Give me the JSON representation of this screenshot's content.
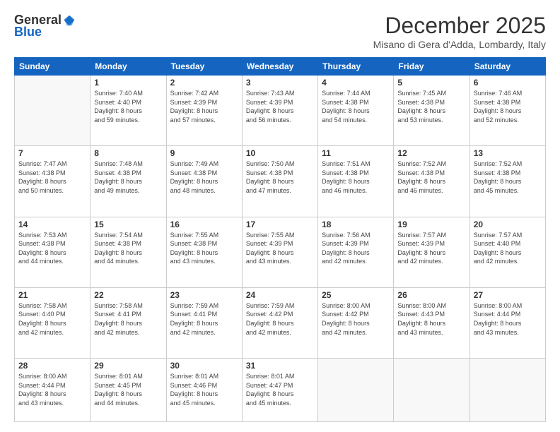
{
  "header": {
    "logo": {
      "general": "General",
      "blue": "Blue"
    },
    "title": "December 2025",
    "location": "Misano di Gera d'Adda, Lombardy, Italy"
  },
  "weekdays": [
    "Sunday",
    "Monday",
    "Tuesday",
    "Wednesday",
    "Thursday",
    "Friday",
    "Saturday"
  ],
  "weeks": [
    [
      {
        "day": "",
        "sunrise": "",
        "sunset": "",
        "daylight": ""
      },
      {
        "day": "1",
        "sunrise": "Sunrise: 7:40 AM",
        "sunset": "Sunset: 4:40 PM",
        "daylight": "Daylight: 8 hours and 59 minutes."
      },
      {
        "day": "2",
        "sunrise": "Sunrise: 7:42 AM",
        "sunset": "Sunset: 4:39 PM",
        "daylight": "Daylight: 8 hours and 57 minutes."
      },
      {
        "day": "3",
        "sunrise": "Sunrise: 7:43 AM",
        "sunset": "Sunset: 4:39 PM",
        "daylight": "Daylight: 8 hours and 56 minutes."
      },
      {
        "day": "4",
        "sunrise": "Sunrise: 7:44 AM",
        "sunset": "Sunset: 4:38 PM",
        "daylight": "Daylight: 8 hours and 54 minutes."
      },
      {
        "day": "5",
        "sunrise": "Sunrise: 7:45 AM",
        "sunset": "Sunset: 4:38 PM",
        "daylight": "Daylight: 8 hours and 53 minutes."
      },
      {
        "day": "6",
        "sunrise": "Sunrise: 7:46 AM",
        "sunset": "Sunset: 4:38 PM",
        "daylight": "Daylight: 8 hours and 52 minutes."
      }
    ],
    [
      {
        "day": "7",
        "sunrise": "Sunrise: 7:47 AM",
        "sunset": "Sunset: 4:38 PM",
        "daylight": "Daylight: 8 hours and 50 minutes."
      },
      {
        "day": "8",
        "sunrise": "Sunrise: 7:48 AM",
        "sunset": "Sunset: 4:38 PM",
        "daylight": "Daylight: 8 hours and 49 minutes."
      },
      {
        "day": "9",
        "sunrise": "Sunrise: 7:49 AM",
        "sunset": "Sunset: 4:38 PM",
        "daylight": "Daylight: 8 hours and 48 minutes."
      },
      {
        "day": "10",
        "sunrise": "Sunrise: 7:50 AM",
        "sunset": "Sunset: 4:38 PM",
        "daylight": "Daylight: 8 hours and 47 minutes."
      },
      {
        "day": "11",
        "sunrise": "Sunrise: 7:51 AM",
        "sunset": "Sunset: 4:38 PM",
        "daylight": "Daylight: 8 hours and 46 minutes."
      },
      {
        "day": "12",
        "sunrise": "Sunrise: 7:52 AM",
        "sunset": "Sunset: 4:38 PM",
        "daylight": "Daylight: 8 hours and 46 minutes."
      },
      {
        "day": "13",
        "sunrise": "Sunrise: 7:52 AM",
        "sunset": "Sunset: 4:38 PM",
        "daylight": "Daylight: 8 hours and 45 minutes."
      }
    ],
    [
      {
        "day": "14",
        "sunrise": "Sunrise: 7:53 AM",
        "sunset": "Sunset: 4:38 PM",
        "daylight": "Daylight: 8 hours and 44 minutes."
      },
      {
        "day": "15",
        "sunrise": "Sunrise: 7:54 AM",
        "sunset": "Sunset: 4:38 PM",
        "daylight": "Daylight: 8 hours and 44 minutes."
      },
      {
        "day": "16",
        "sunrise": "Sunrise: 7:55 AM",
        "sunset": "Sunset: 4:38 PM",
        "daylight": "Daylight: 8 hours and 43 minutes."
      },
      {
        "day": "17",
        "sunrise": "Sunrise: 7:55 AM",
        "sunset": "Sunset: 4:39 PM",
        "daylight": "Daylight: 8 hours and 43 minutes."
      },
      {
        "day": "18",
        "sunrise": "Sunrise: 7:56 AM",
        "sunset": "Sunset: 4:39 PM",
        "daylight": "Daylight: 8 hours and 42 minutes."
      },
      {
        "day": "19",
        "sunrise": "Sunrise: 7:57 AM",
        "sunset": "Sunset: 4:39 PM",
        "daylight": "Daylight: 8 hours and 42 minutes."
      },
      {
        "day": "20",
        "sunrise": "Sunrise: 7:57 AM",
        "sunset": "Sunset: 4:40 PM",
        "daylight": "Daylight: 8 hours and 42 minutes."
      }
    ],
    [
      {
        "day": "21",
        "sunrise": "Sunrise: 7:58 AM",
        "sunset": "Sunset: 4:40 PM",
        "daylight": "Daylight: 8 hours and 42 minutes."
      },
      {
        "day": "22",
        "sunrise": "Sunrise: 7:58 AM",
        "sunset": "Sunset: 4:41 PM",
        "daylight": "Daylight: 8 hours and 42 minutes."
      },
      {
        "day": "23",
        "sunrise": "Sunrise: 7:59 AM",
        "sunset": "Sunset: 4:41 PM",
        "daylight": "Daylight: 8 hours and 42 minutes."
      },
      {
        "day": "24",
        "sunrise": "Sunrise: 7:59 AM",
        "sunset": "Sunset: 4:42 PM",
        "daylight": "Daylight: 8 hours and 42 minutes."
      },
      {
        "day": "25",
        "sunrise": "Sunrise: 8:00 AM",
        "sunset": "Sunset: 4:42 PM",
        "daylight": "Daylight: 8 hours and 42 minutes."
      },
      {
        "day": "26",
        "sunrise": "Sunrise: 8:00 AM",
        "sunset": "Sunset: 4:43 PM",
        "daylight": "Daylight: 8 hours and 43 minutes."
      },
      {
        "day": "27",
        "sunrise": "Sunrise: 8:00 AM",
        "sunset": "Sunset: 4:44 PM",
        "daylight": "Daylight: 8 hours and 43 minutes."
      }
    ],
    [
      {
        "day": "28",
        "sunrise": "Sunrise: 8:00 AM",
        "sunset": "Sunset: 4:44 PM",
        "daylight": "Daylight: 8 hours and 43 minutes."
      },
      {
        "day": "29",
        "sunrise": "Sunrise: 8:01 AM",
        "sunset": "Sunset: 4:45 PM",
        "daylight": "Daylight: 8 hours and 44 minutes."
      },
      {
        "day": "30",
        "sunrise": "Sunrise: 8:01 AM",
        "sunset": "Sunset: 4:46 PM",
        "daylight": "Daylight: 8 hours and 45 minutes."
      },
      {
        "day": "31",
        "sunrise": "Sunrise: 8:01 AM",
        "sunset": "Sunset: 4:47 PM",
        "daylight": "Daylight: 8 hours and 45 minutes."
      },
      {
        "day": "",
        "sunrise": "",
        "sunset": "",
        "daylight": ""
      },
      {
        "day": "",
        "sunrise": "",
        "sunset": "",
        "daylight": ""
      },
      {
        "day": "",
        "sunrise": "",
        "sunset": "",
        "daylight": ""
      }
    ]
  ]
}
